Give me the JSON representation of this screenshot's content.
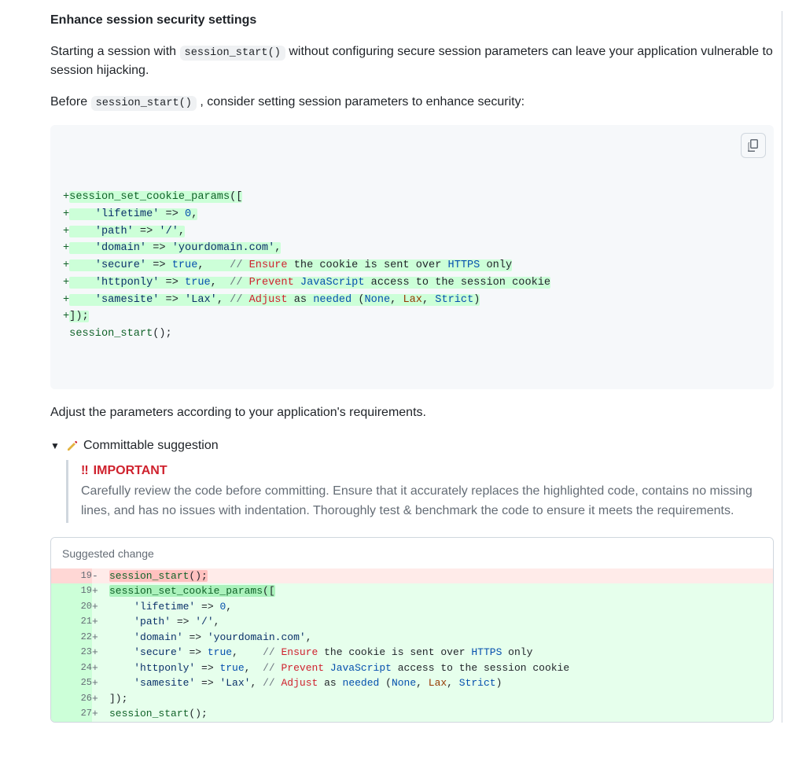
{
  "heading": "Enhance session security settings",
  "intro": {
    "pre": "Starting a session with ",
    "code": "session_start()",
    "post": " without configuring secure session parameters can leave your application vulnerable to session hijacking."
  },
  "before_line": {
    "pre": "Before ",
    "code": "session_start()",
    "post": " , consider setting session parameters to enhance security:"
  },
  "code_block": {
    "lines": [
      "+session_set_cookie_params([",
      "+    'lifetime' => 0,",
      "+    'path' => '/',",
      "+    'domain' => 'yourdomain.com',",
      "+    'secure' => true,    // Ensure the cookie is sent over HTTPS only",
      "+    'httponly' => true,  // Prevent JavaScript access to the session cookie",
      "+    'samesite' => 'Lax', // Adjust as needed (None, Lax, Strict)",
      "+]);",
      " session_start();"
    ]
  },
  "adjust_text": "Adjust the parameters according to your application's requirements.",
  "committable": {
    "summary": "Committable suggestion",
    "important_label": "IMPORTANT",
    "important_body": "Carefully review the code before committing. Ensure that it accurately replaces the highlighted code, contains no missing lines, and has no issues with indentation. Thoroughly test & benchmark the code to ensure it meets the requirements."
  },
  "suggested_change_label": "Suggested change",
  "diff": {
    "deleted": {
      "num": "19",
      "text": "session_start();"
    },
    "added": [
      {
        "num": "19",
        "text": "session_set_cookie_params([",
        "strong": true
      },
      {
        "num": "20",
        "text": "    'lifetime' => 0,"
      },
      {
        "num": "21",
        "text": "    'path' => '/',"
      },
      {
        "num": "22",
        "text": "    'domain' => 'yourdomain.com',"
      },
      {
        "num": "23",
        "text": "    'secure' => true,    // Ensure the cookie is sent over HTTPS only"
      },
      {
        "num": "24",
        "text": "    'httponly' => true,  // Prevent JavaScript access to the session cookie"
      },
      {
        "num": "25",
        "text": "    'samesite' => 'Lax', // Adjust as needed (None, Lax, Strict)"
      },
      {
        "num": "26",
        "text": "]);"
      },
      {
        "num": "27",
        "text": "session_start();"
      }
    ]
  }
}
